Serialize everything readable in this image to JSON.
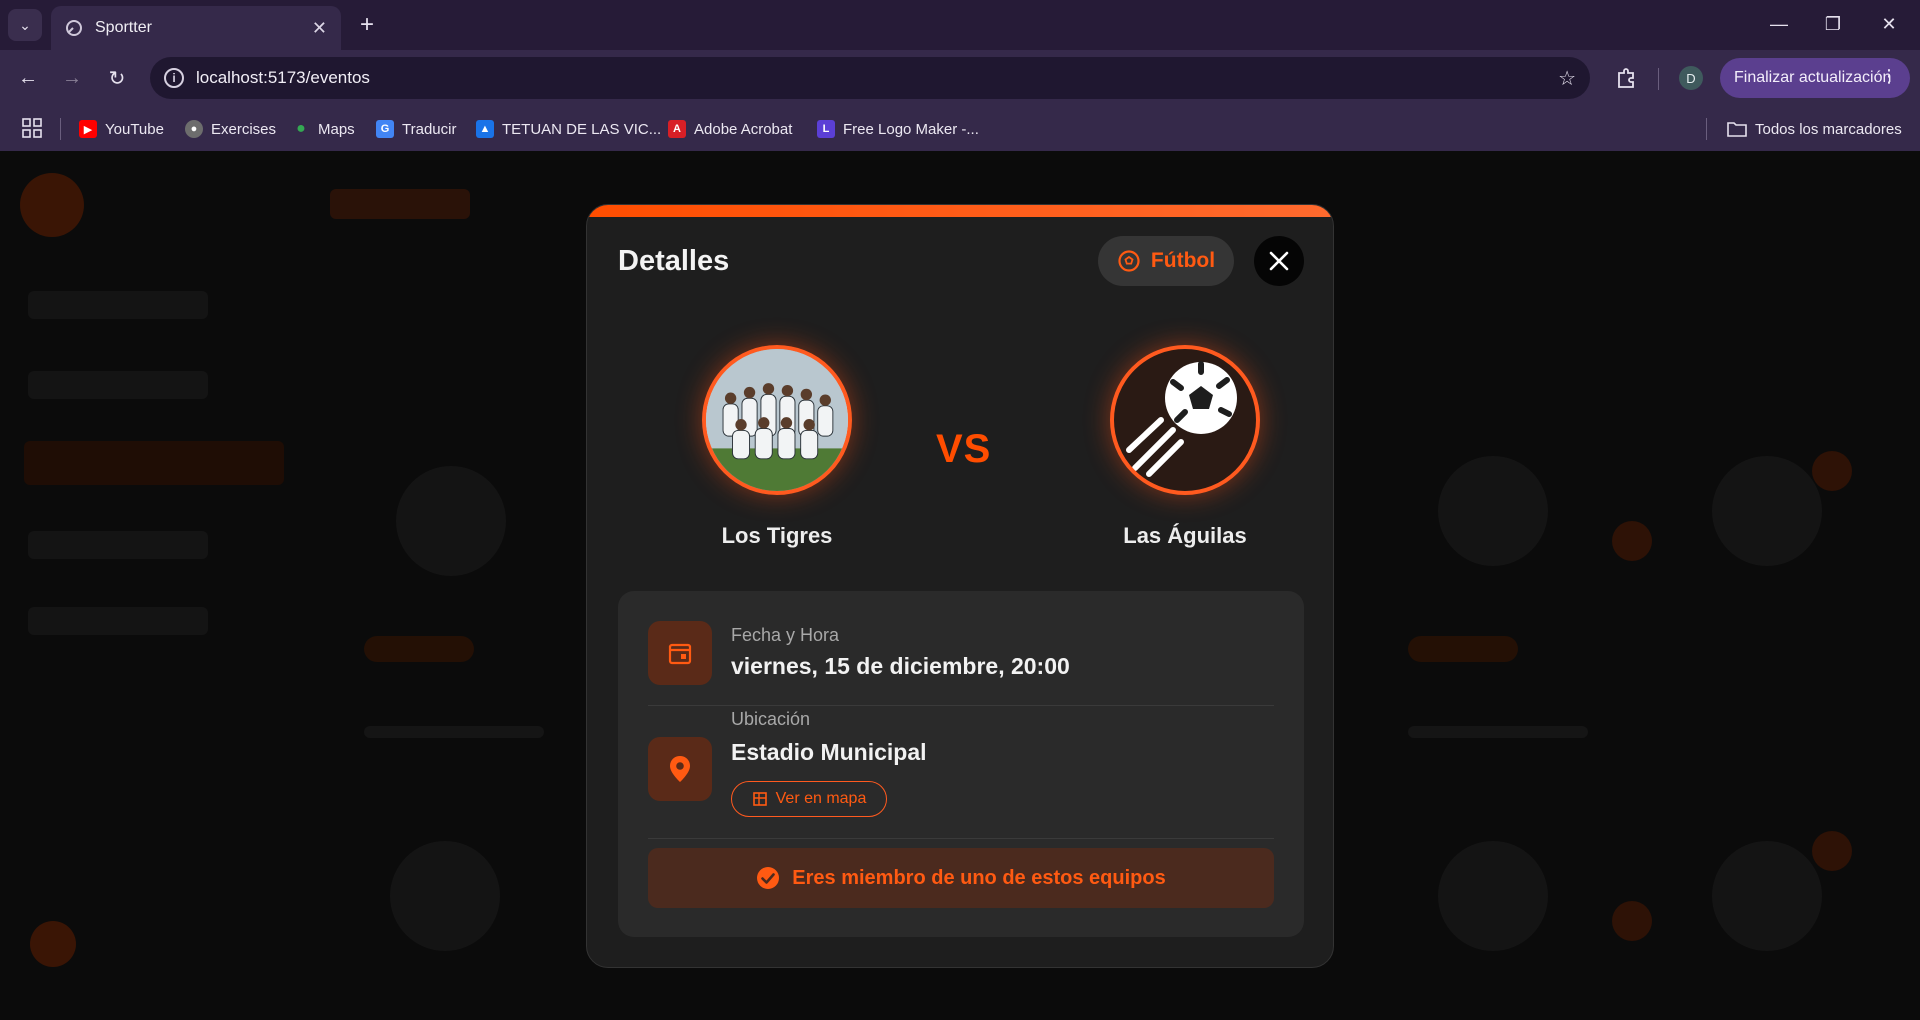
{
  "browser": {
    "tab_title": "Sportter",
    "url": "localhost:5173/eventos",
    "update_label": "Finalizar actualización",
    "profile_initial": "D",
    "bookmarks": [
      {
        "label": "YouTube",
        "icon": "youtube-icon",
        "color": "#ff0000"
      },
      {
        "label": "Exercises",
        "icon": "globe-icon",
        "color": "#8a8a8a"
      },
      {
        "label": "Maps",
        "icon": "maps-icon",
        "color": "#34a853"
      },
      {
        "label": "Traducir",
        "icon": "translate-icon",
        "color": "#4285f4"
      },
      {
        "label": "TETUAN DE LAS VIC...",
        "icon": "school-icon",
        "color": "#1a73e8"
      },
      {
        "label": "Adobe Acrobat",
        "icon": "acrobat-icon",
        "color": "#d81f26"
      },
      {
        "label": "Free Logo Maker -...",
        "icon": "logo-maker-icon",
        "color": "#5b3fd6"
      }
    ],
    "all_bookmarks_label": "Todos los marcadores"
  },
  "modal": {
    "title": "Detalles",
    "sport": "Fútbol",
    "home_team": "Los Tigres",
    "away_team": "Las Águilas",
    "vs_label": "VS",
    "datetime_label": "Fecha y Hora",
    "datetime_value": "viernes, 15 de diciembre, 20:00",
    "location_label": "Ubicación",
    "location_value": "Estadio Municipal",
    "map_button": "Ver en mapa",
    "member_message": "Eres miembro de uno de estos equipos"
  },
  "colors": {
    "accent": "#ff4d00",
    "modal_bg": "#1e1e1e",
    "card_bg": "#2a2a2a",
    "browser_frame": "#35294a"
  }
}
